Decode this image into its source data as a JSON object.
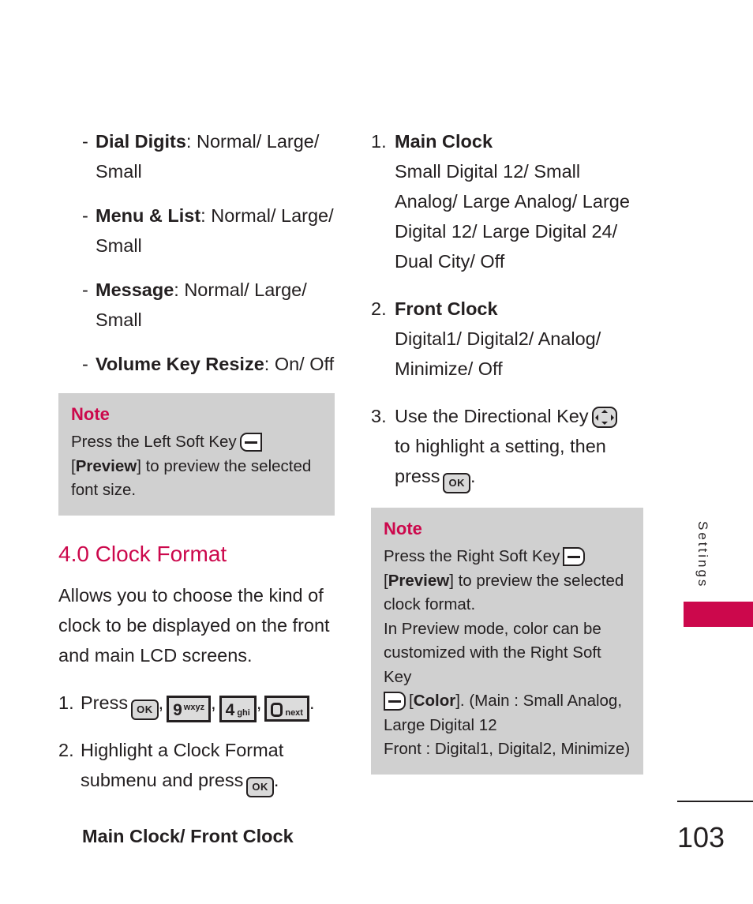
{
  "left_column": {
    "font_size_options": [
      {
        "label": "Dial Digits",
        "values": ": Normal/ Large/ Small"
      },
      {
        "label": "Menu & List",
        "values": ": Normal/ Large/ Small"
      },
      {
        "label": "Message",
        "values": ": Normal/ Large/ Small"
      },
      {
        "label": "Volume Key Resize",
        "values": ": On/ Off"
      }
    ],
    "note": {
      "title": "Note",
      "line1_pre": "Press the Left Soft Key",
      "line1_post": "",
      "line2_bracket_open": "[",
      "line2_bold": "Preview",
      "line2_rest": "] to preview the selected font size.",
      "soft_key_icon": "left-soft-key-icon"
    },
    "section": {
      "heading": "4.0 Clock Format",
      "description": "Allows you to choose the kind of clock to be displayed on the front and main  LCD screens."
    },
    "step1": {
      "number": "1.",
      "text": "Press",
      "keys": [
        {
          "icon": "ok-key-icon",
          "label": "OK"
        },
        {
          "icon": "keypad-9-icon",
          "big": "9",
          "sup": "wxyz"
        },
        {
          "icon": "keypad-4-icon",
          "big": "4",
          "sub": "ghi"
        },
        {
          "icon": "keypad-0-next-icon",
          "big": "0",
          "sub": "next"
        }
      ],
      "separator": ",",
      "terminator": "."
    },
    "step2": {
      "number": "2.",
      "text_before": "Highlight a Clock Format submenu and press",
      "ok_key": "OK",
      "text_after": "."
    },
    "submenu_heading": "Main Clock/ Front Clock"
  },
  "right_column": {
    "clock_items": [
      {
        "number": "1.",
        "title": "Main Clock",
        "options": "Small Digital 12/ Small Analog/ Large Analog/ Large Digital 12/ Large Digital 24/ Dual City/ Off"
      },
      {
        "number": "2.",
        "title": "Front Clock",
        "options": "Digital1/ Digital2/ Analog/ Minimize/ Off"
      }
    ],
    "step3": {
      "number": "3.",
      "text_before": "Use the Directional Key",
      "text_middle": "to highlight a setting, then press",
      "ok_key": "OK",
      "text_after": ".",
      "dir_key_icon": "directional-key-icon"
    },
    "note": {
      "title": "Note",
      "line1": "Press the Right Soft Key",
      "line2_bracket_open": "[",
      "line2_bold": "Preview",
      "line2_rest": "] to preview the selected clock format.",
      "line3": "In Preview mode, color can be customized with the Right Soft Key",
      "line4_bracket_open": "[",
      "line4_bold": "Color",
      "line4_rest": "]. (Main : Small Analog, Large Digital 12",
      "line5": "Front : Digital1, Digital2, Minimize)",
      "soft_key_icon": "right-soft-key-icon"
    }
  },
  "side_tab": {
    "label": "Settings",
    "accent_color": "#cc084c"
  },
  "footer": {
    "page_number": "103"
  },
  "colors": {
    "accent": "#cc084c",
    "note_background": "#d0d0d0",
    "text": "#231f20"
  }
}
